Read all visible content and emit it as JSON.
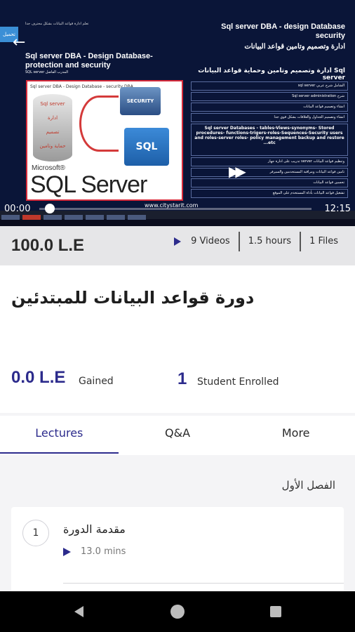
{
  "video": {
    "slide_title_right": "Sql server DBA - design Database security",
    "slide_subtitle_right": "ادارة وتصميم وتامين قواعد البيانات",
    "slide_title_left": "Sql server DBA - Design Database- protection and security",
    "slide_caption": "Sql server DBA - Design Database - security DBA",
    "right_heading": "ادارة وتصميم وتامين وحماية قواعد البيانات Sql server",
    "top_arabic": "تعلم ادارة قواعد البيانات بشكل محترف جدا",
    "side_tab": "تحميل",
    "small_arabic": "SQL server المدرب الفاضل",
    "topics": [
      "sql server الشامل شرح عربي",
      "Sql server administration شرح",
      "انشاء وتصميم قواعد البيانات",
      "انشاء وتصميم الجداول والعلاقات بشكل قوي جدا",
      "Sql server Databases - tables-Views-synonyms- Stored procedures- functions-trigers-roles-Sequences-Security users and roles-server roles- policy management backup and restore ...etc",
      "تدريب على ادارة جهاز server وتنظيم قواعد البيانات",
      "تامين قواعد البيانات ومراقبة المستخدمين والسيرفر",
      "تحسين قواعد البيانات",
      "تشغيل قواعد البيانات بأداة المستخدم على الموقع"
    ],
    "logo_ms": "Microsoft®",
    "logo_sql": "SQL Server",
    "db_labels": [
      "Sql server",
      "ادارة",
      "تصميم",
      "حماية وتامين"
    ],
    "sec_label": "SECURITY",
    "sql_box_label": "SQL",
    "site": "www.citystarit.com",
    "time_elapsed": "00:00",
    "time_total": "12:15",
    "progress_fraction": 0.02
  },
  "info": {
    "price": "100.0 L.E",
    "videos": "9 Videos",
    "hours": "1.5 hours",
    "files": "1 Files"
  },
  "course": {
    "title": "دورة قواعد البيانات للمبتدئين",
    "gained_value": "0.0 L.E",
    "gained_label": "Gained",
    "enrolled_value": "1",
    "enrolled_label": "Student Enrolled"
  },
  "tabs": [
    {
      "label": "Lectures",
      "active": true
    },
    {
      "label": "Q&A",
      "active": false
    },
    {
      "label": "More",
      "active": false
    }
  ],
  "section": {
    "title": "الفصل الأول",
    "lecture": {
      "number": "1",
      "title": "مقدمة الدورة",
      "duration": "13.0 mins"
    }
  },
  "colors": {
    "accent": "#2c2b8c",
    "info_bar": "#e6e6e8",
    "page_bg": "#f4f4f6"
  }
}
